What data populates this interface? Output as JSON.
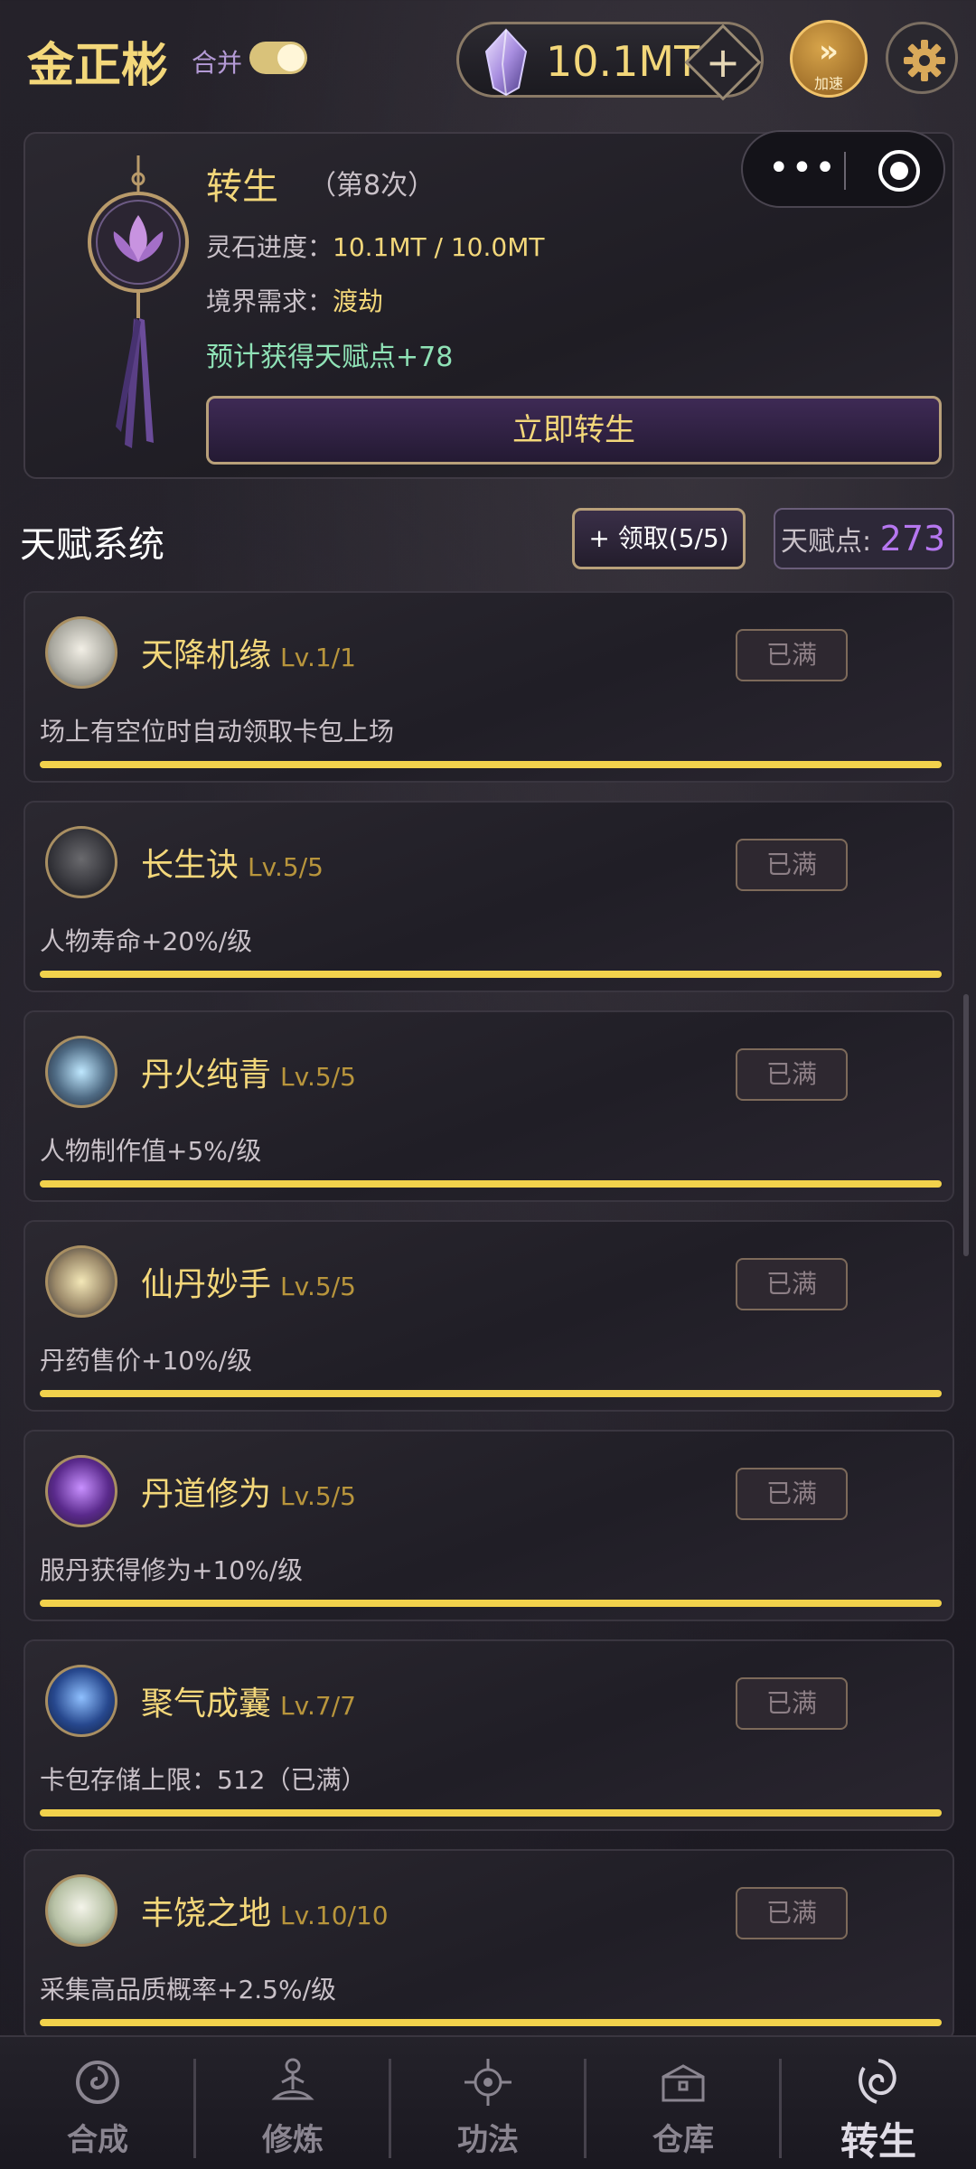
{
  "header": {
    "player_name": "金正彬",
    "merge_label": "合并",
    "merge_enabled": true,
    "currency_value": "10.1MT",
    "currency_icon": "crystal-icon",
    "plus_label": "+",
    "speed_arrows": "»",
    "speed_label": "加速",
    "settings_icon": "gear-icon"
  },
  "rebirth": {
    "title": "转生",
    "count": "（第8次）",
    "progress_label": "灵石进度：",
    "progress_value": "10.1MT / 10.0MT",
    "realm_label": "境界需求：",
    "realm_value": "渡劫",
    "bonus": "预计获得天赋点+78",
    "button_label": "立即转生",
    "accent": "#f3d77a"
  },
  "capsule": {
    "dots": "•••"
  },
  "talents_header": {
    "title": "天赋系统",
    "claim_label": "+ 领取(5/5)",
    "points_label": "天赋点: ",
    "points_value": "273"
  },
  "talents": [
    {
      "name": "天降机缘",
      "level": "Lv.1/1",
      "desc": "场上有空位时自动领取卡包上场",
      "status": "已满",
      "progress": 1.0
    },
    {
      "name": "长生诀",
      "level": "Lv.5/5",
      "desc": "人物寿命+20%/级",
      "status": "已满",
      "progress": 1.0
    },
    {
      "name": "丹火纯青",
      "level": "Lv.5/5",
      "desc": "人物制作值+5%/级",
      "status": "已满",
      "progress": 1.0
    },
    {
      "name": "仙丹妙手",
      "level": "Lv.5/5",
      "desc": "丹药售价+10%/级",
      "status": "已满",
      "progress": 1.0
    },
    {
      "name": "丹道修为",
      "level": "Lv.5/5",
      "desc": "服丹获得修为+10%/级",
      "status": "已满",
      "progress": 1.0
    },
    {
      "name": "聚气成囊",
      "level": "Lv.7/7",
      "desc": "卡包存储上限：512（已满）",
      "status": "已满",
      "progress": 1.0
    },
    {
      "name": "丰饶之地",
      "level": "Lv.10/10",
      "desc": "采集高品质概率+2.5%/级",
      "status": "已满",
      "progress": 1.0
    }
  ],
  "nav": {
    "items": [
      {
        "label": "合成",
        "icon": "swirl-icon"
      },
      {
        "label": "修炼",
        "icon": "meditation-icon"
      },
      {
        "label": "功法",
        "icon": "emblem-icon"
      },
      {
        "label": "仓库",
        "icon": "chest-icon"
      },
      {
        "label": "转生",
        "icon": "vortex-icon"
      }
    ],
    "active": 4
  },
  "colors": {
    "gold": "#f3d77a",
    "purple": "#b677f0",
    "green": "#8fe2b6",
    "bar": "#f2d24c"
  }
}
